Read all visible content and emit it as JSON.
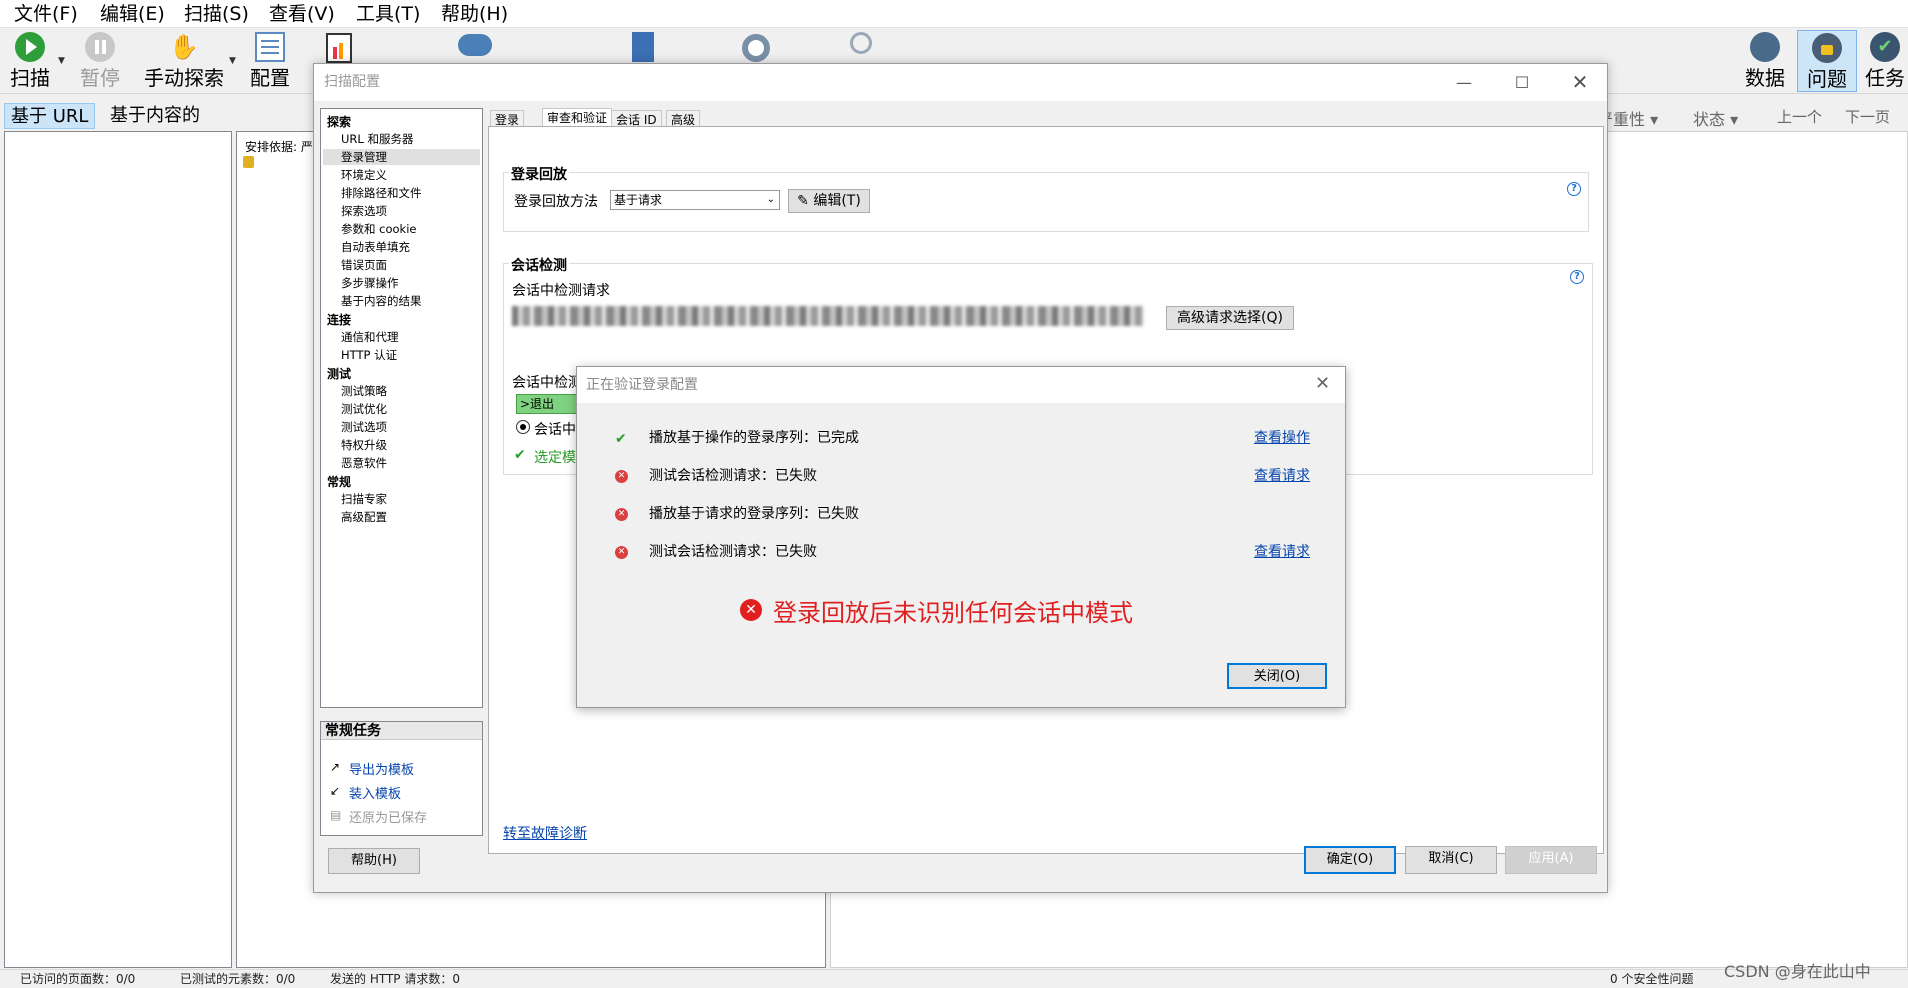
{
  "menu": [
    "文件(F)",
    "编辑(E)",
    "扫描(S)",
    "查看(V)",
    "工具(T)",
    "帮助(H)"
  ],
  "toolbar": {
    "scan": "扫描",
    "pause": "暂停",
    "manual": "手动探索",
    "config": "配置",
    "data": "数据",
    "issues": "问题",
    "tasks": "任务"
  },
  "left_tabs": [
    "基于 URL",
    "基于内容的"
  ],
  "schedule_label": "安排依据: 严",
  "right_header": {
    "sev": "严重性 ▾",
    "status": "状态 ▾",
    "prev": "上一个",
    "next": "下一页"
  },
  "dialog": {
    "title": "扫描配置",
    "tree": [
      {
        "type": "cat",
        "label": "探索"
      },
      {
        "type": "item",
        "label": "URL 和服务器"
      },
      {
        "type": "item",
        "label": "登录管理",
        "selected": true
      },
      {
        "type": "item",
        "label": "环境定义"
      },
      {
        "type": "item",
        "label": "排除路径和文件"
      },
      {
        "type": "item",
        "label": "探索选项"
      },
      {
        "type": "item",
        "label": "参数和 cookie"
      },
      {
        "type": "item",
        "label": "自动表单填充"
      },
      {
        "type": "item",
        "label": "错误页面"
      },
      {
        "type": "item",
        "label": "多步骤操作"
      },
      {
        "type": "item",
        "label": "基于内容的结果"
      },
      {
        "type": "cat",
        "label": "连接"
      },
      {
        "type": "item",
        "label": "通信和代理"
      },
      {
        "type": "item",
        "label": "HTTP 认证"
      },
      {
        "type": "cat",
        "label": "测试"
      },
      {
        "type": "item",
        "label": "测试策略"
      },
      {
        "type": "item",
        "label": "测试优化"
      },
      {
        "type": "item",
        "label": "测试选项"
      },
      {
        "type": "item",
        "label": "特权升级"
      },
      {
        "type": "item",
        "label": "恶意软件"
      },
      {
        "type": "cat",
        "label": "常规"
      },
      {
        "type": "item",
        "label": "扫描专家"
      },
      {
        "type": "item",
        "label": "高级配置"
      }
    ],
    "tasks_title": "常规任务",
    "tasks": [
      "导出为模板",
      "装入模板",
      "还原为已保存"
    ],
    "help_button": "帮助(H)",
    "tabs": [
      "登录",
      "审查和验证",
      "会话 ID",
      "高级"
    ],
    "login_replay": {
      "title": "登录回放",
      "method_label": "登录回放方法",
      "method_value": "基于请求",
      "edit_button": "编辑(T)"
    },
    "session": {
      "title": "会话检测",
      "request_label": "会话中检测请求",
      "advanced_button": "高级请求选择(Q)",
      "pattern_label": "会话中检测模式",
      "pattern_value": ">退出",
      "radio_label": "会话中",
      "selected_label": "选定模"
    },
    "diag_link": "转至故障诊断",
    "ok": "确定(O)",
    "cancel": "取消(C)",
    "apply": "应用(A)"
  },
  "verify": {
    "title": "正在验证登录配置",
    "rows": [
      {
        "ok": true,
        "text": "播放基于操作的登录序列：已完成",
        "link": "查看操作"
      },
      {
        "ok": false,
        "text": "测试会话检测请求：已失败",
        "link": "查看请求"
      },
      {
        "ok": false,
        "text": "播放基于请求的登录序列：已失败",
        "link": ""
      },
      {
        "ok": false,
        "text": "测试会话检测请求：已失败",
        "link": "查看请求"
      }
    ],
    "error": "登录回放后未识别任何会话中模式",
    "close": "关闭(O)"
  },
  "status": {
    "visited": "已访问的页面数：0/0",
    "tested": "已测试的元素数：0/0",
    "sent": "发送的 HTTP 请求数：0",
    "issues": "0 个安全性问题",
    "watermark": "CSDN @身在此山中"
  },
  "colors": {
    "error_red": "#e02020",
    "link_blue": "#0645ad",
    "accent": "#0078d7",
    "ok_green": "#2a9d2a"
  }
}
